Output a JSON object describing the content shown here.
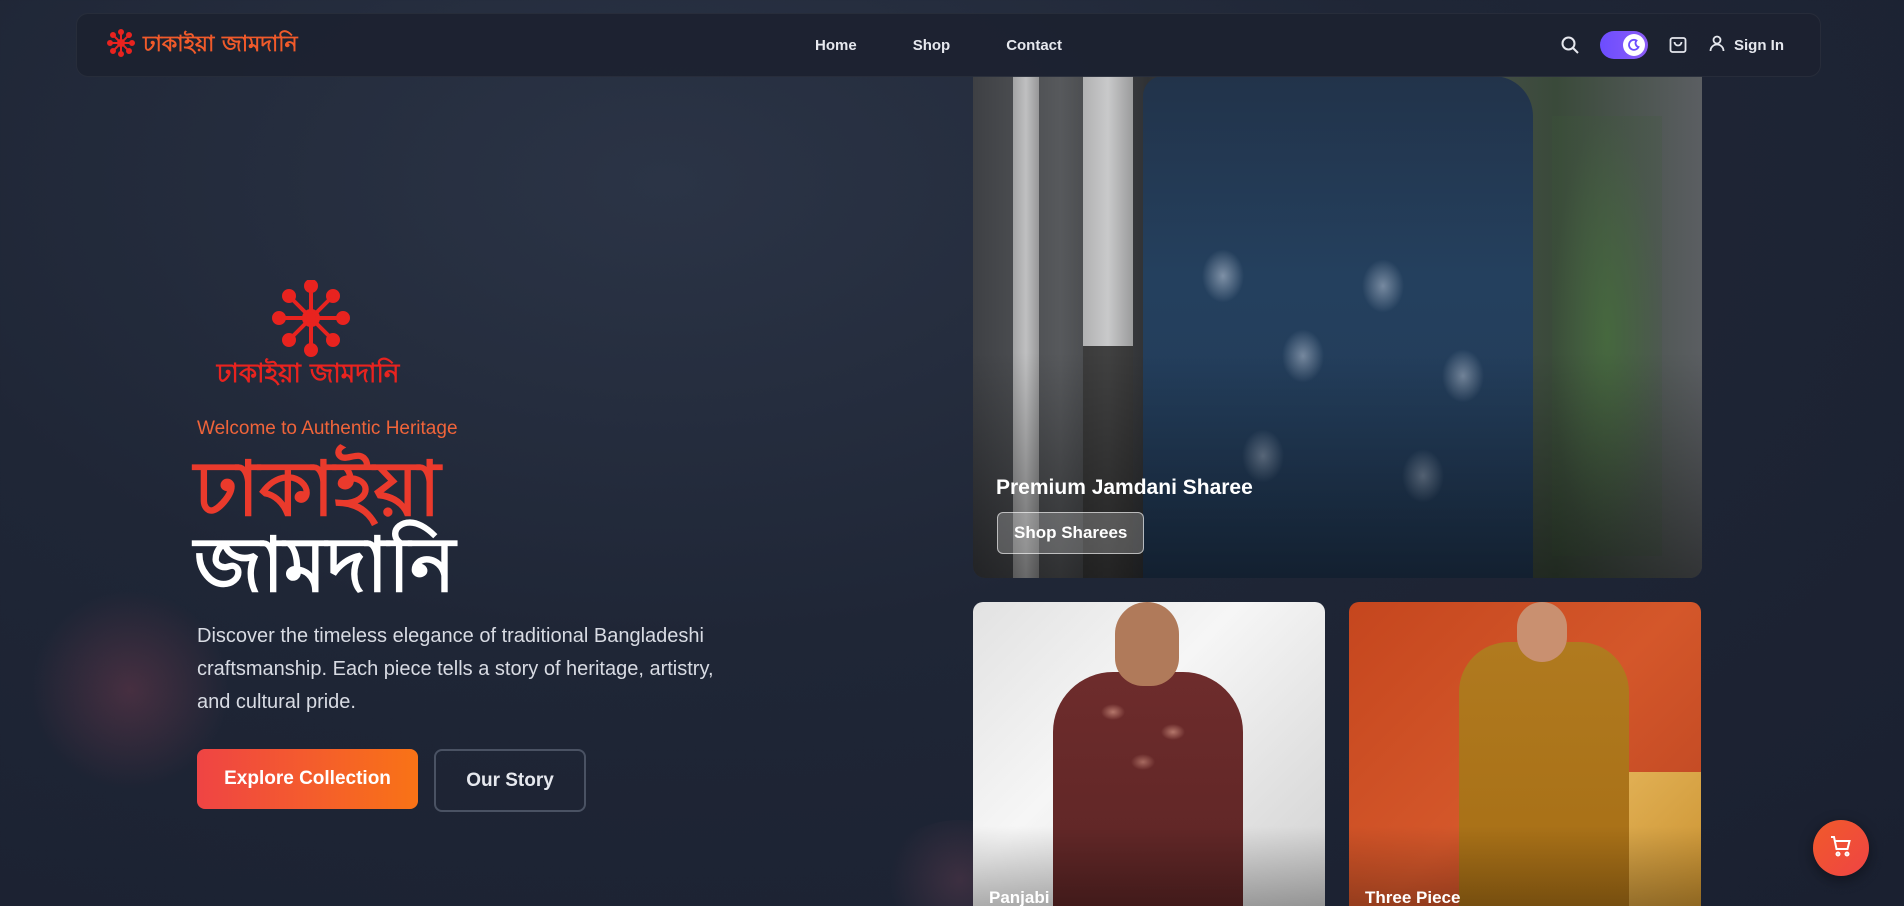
{
  "brand": {
    "name": "ঢাকাইয়া জামদানি",
    "logo_text": "ঢাকাইয়া জামদানি",
    "color": "#f05a2a"
  },
  "nav": {
    "links": [
      {
        "label": "Home"
      },
      {
        "label": "Shop"
      },
      {
        "label": "Contact"
      }
    ],
    "sign_in_label": "Sign In",
    "icons": [
      "search-icon",
      "theme-toggle",
      "shopping-bag-icon",
      "user-icon"
    ]
  },
  "hero": {
    "welcome": "Welcome to Authentic Heritage",
    "title_line_1": "ঢাকাইয়া",
    "title_line_2": "জামদানি",
    "description": "Discover the timeless elegance of traditional Bangladeshi craftsmanship. Each piece tells a story of heritage, artistry, and cultural pride.",
    "primary_cta": "Explore Collection",
    "secondary_cta": "Our Story",
    "accent_colors": [
      "#ef4444",
      "#f97316"
    ]
  },
  "cards": {
    "main": {
      "title": "Premium Jamdani Sharee",
      "button": "Shop Sharees"
    },
    "panjabi": {
      "label": "Panjabi"
    },
    "three_piece": {
      "label": "Three Piece"
    }
  },
  "fab": {
    "icon": "cart-icon"
  }
}
